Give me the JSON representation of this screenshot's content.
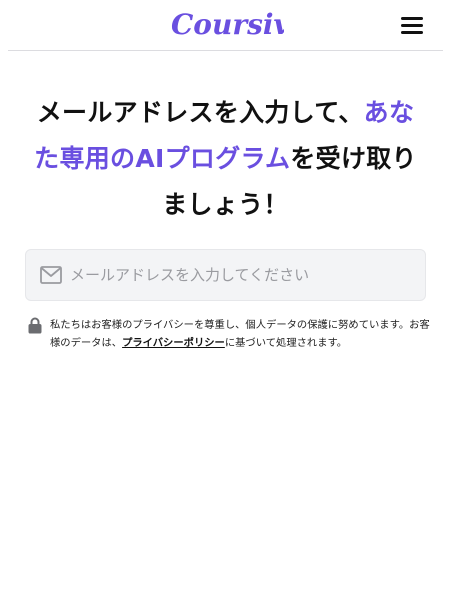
{
  "header": {
    "logo_text": "Coursiv",
    "brand_color": "#6a4fe0"
  },
  "headline": {
    "line1_plain": "メールアドレスを入力して、",
    "line1_accent": "あな",
    "line2_accent": "た専用のAIプログラム",
    "line2_plain": "を受け取り",
    "line3_plain": "ましょう！"
  },
  "email": {
    "placeholder": "メールアドレスを入力してください",
    "value": "",
    "icon": "mail-icon"
  },
  "privacy": {
    "icon": "lock-icon",
    "text_before": "私たちはお客様のプライバシーを尊重し、個人データの保護に努めています。お客様のデータは、",
    "link_text": "プライバシーポリシー",
    "text_after": "に基づいて処理されます。"
  }
}
